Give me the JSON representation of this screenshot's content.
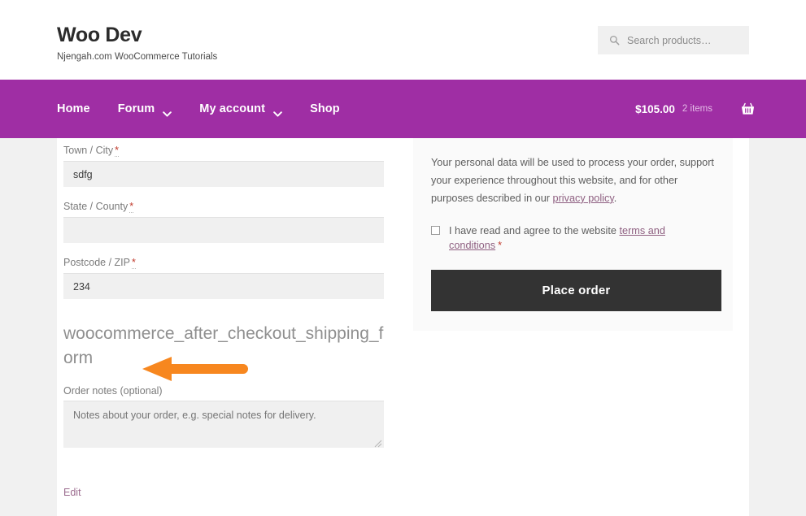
{
  "header": {
    "brand_title": "Woo Dev",
    "brand_tagline": "Njengah.com WooCommerce Tutorials",
    "search": {
      "icon": "search-icon",
      "placeholder": "Search products…",
      "value": ""
    }
  },
  "nav": {
    "background_color": "#9f2ea4",
    "items": [
      {
        "label": "Home",
        "has_dropdown": false
      },
      {
        "label": "Forum",
        "has_dropdown": true
      },
      {
        "label": "My account",
        "has_dropdown": true
      },
      {
        "label": "Shop",
        "has_dropdown": false
      }
    ],
    "cart": {
      "total": "$105.00",
      "count": "2 items",
      "icon": "shopping-basket-icon"
    }
  },
  "checkout": {
    "fields": [
      {
        "label": "Town / City",
        "required_mark": "*",
        "value": "sdfg",
        "placeholder": ""
      },
      {
        "label": "State / County",
        "required_mark": "*",
        "value": "",
        "placeholder": ""
      },
      {
        "label": "Postcode / ZIP",
        "required_mark": "*",
        "value": "234",
        "placeholder": ""
      }
    ],
    "hook_name": "woocommerce_after_checkout_shipping_form",
    "annotation": {
      "type": "arrow-left",
      "color": "#f7871f"
    },
    "order_notes": {
      "label": "Order notes (optional)",
      "placeholder": "Notes about your order, e.g. special notes for delivery.",
      "value": ""
    },
    "edit_link": "Edit"
  },
  "order_review": {
    "privacy_text_before": "Your personal data will be used to process your order, support your experience throughout this website, and for other purposes described in our ",
    "privacy_link": "privacy policy",
    "privacy_text_after": ".",
    "terms_text_before": "I have read and agree to the website ",
    "terms_link": "terms and conditions",
    "terms_star": "*",
    "terms_checked": false,
    "place_order_label": "Place order",
    "place_order_color": "#333333"
  }
}
